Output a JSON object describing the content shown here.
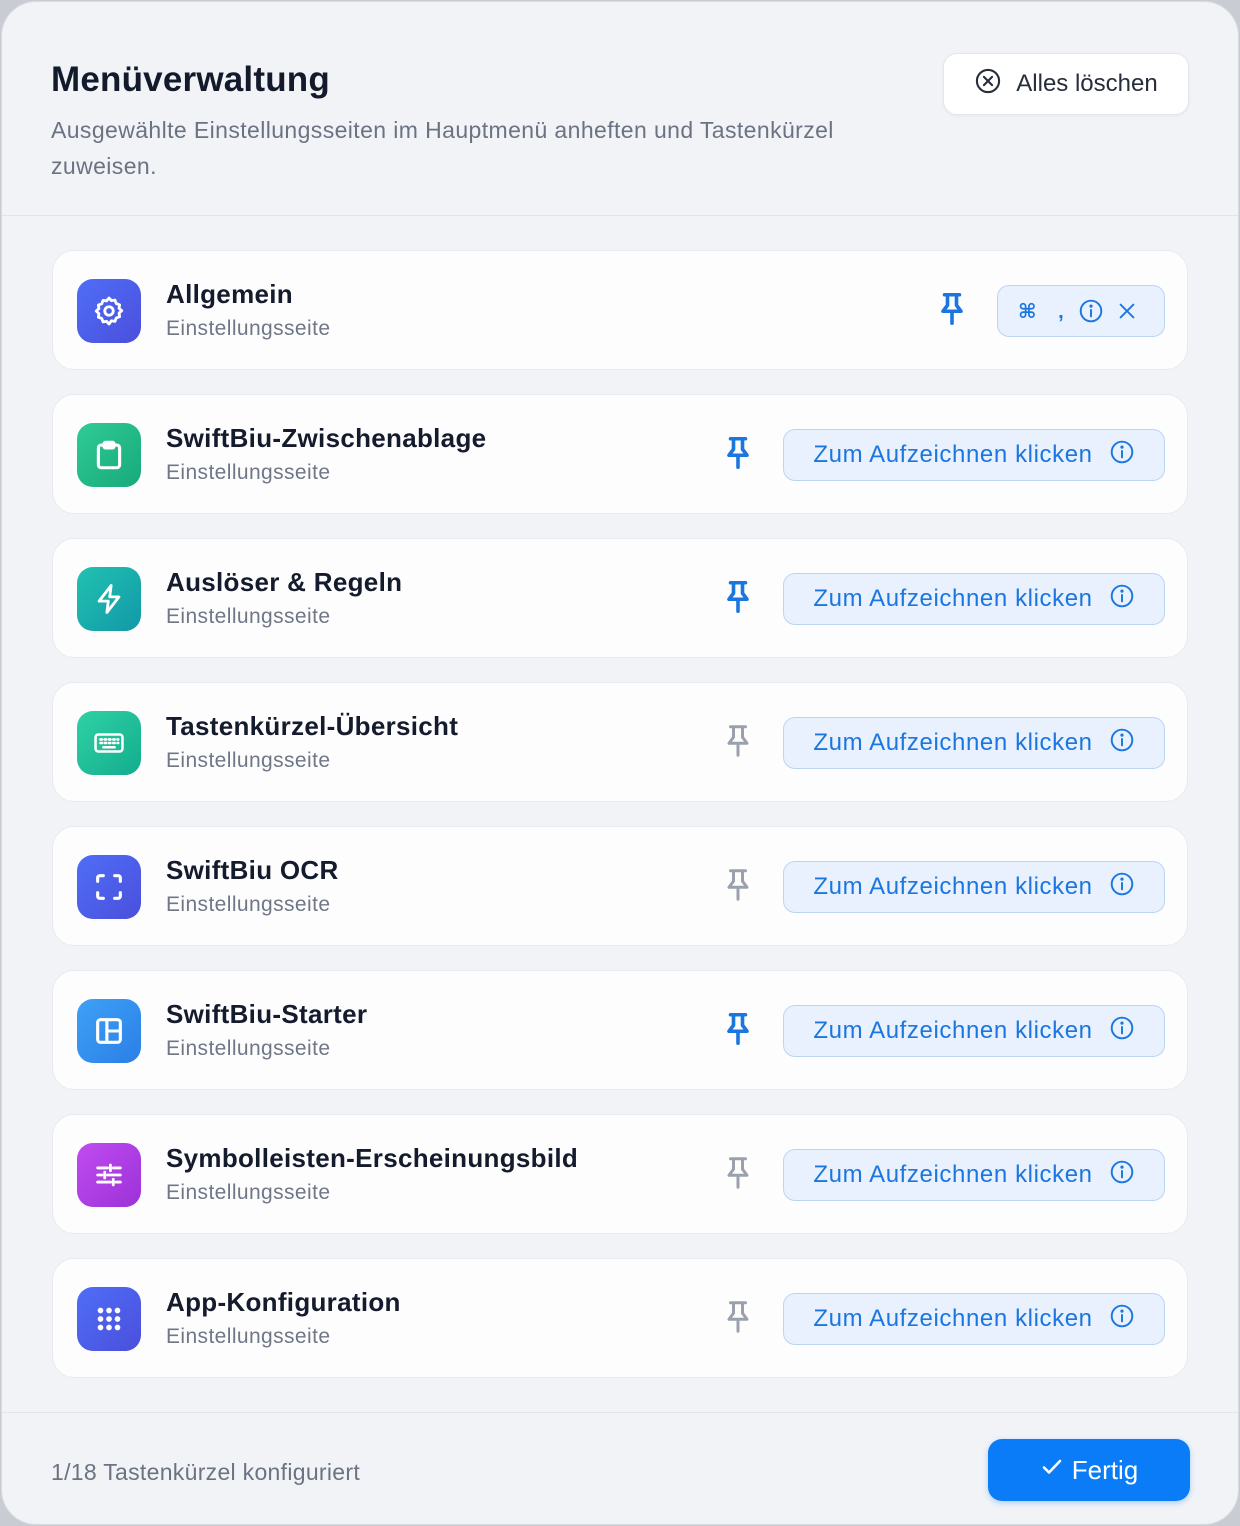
{
  "header": {
    "title": "Menüverwaltung",
    "subtitle": "Ausgewählte Einstellungsseiten im Hauptmenü anheften und Tastenkürzel zuweisen.",
    "clear_all_label": "Alles löschen"
  },
  "colors": {
    "accent": "#0a7cf7",
    "pinned": "#1b76df",
    "unpinned": "#9aa1ad"
  },
  "items": [
    {
      "title": "Allgemein",
      "subtitle": "Einstellungsseite",
      "icon": "gear-icon",
      "pinned": true,
      "shortcut_keys": "⌘ ,"
    },
    {
      "title": "SwiftBiu-Zwischenablage",
      "subtitle": "Einstellungsseite",
      "icon": "clipboard-icon",
      "pinned": true,
      "record_label": "Zum Aufzeichnen klicken"
    },
    {
      "title": "Auslöser & Regeln",
      "subtitle": "Einstellungsseite",
      "icon": "lightning-icon",
      "pinned": true,
      "record_label": "Zum Aufzeichnen klicken"
    },
    {
      "title": "Tastenkürzel-Übersicht",
      "subtitle": "Einstellungsseite",
      "icon": "keyboard-icon",
      "pinned": false,
      "record_label": "Zum Aufzeichnen klicken"
    },
    {
      "title": "SwiftBiu OCR",
      "subtitle": "Einstellungsseite",
      "icon": "scan-icon",
      "pinned": false,
      "record_label": "Zum Aufzeichnen klicken"
    },
    {
      "title": "SwiftBiu-Starter",
      "subtitle": "Einstellungsseite",
      "icon": "layout-icon",
      "pinned": true,
      "record_label": "Zum Aufzeichnen klicken"
    },
    {
      "title": "Symbolleisten-Erscheinungsbild",
      "subtitle": "Einstellungsseite",
      "icon": "sliders-icon",
      "pinned": false,
      "record_label": "Zum Aufzeichnen klicken"
    },
    {
      "title": "App-Konfiguration",
      "subtitle": "Einstellungsseite",
      "icon": "grid-dots-icon",
      "pinned": false,
      "record_label": "Zum Aufzeichnen klicken"
    }
  ],
  "footer": {
    "status": "1/18 Tastenkürzel konfiguriert",
    "done_label": "Fertig"
  }
}
